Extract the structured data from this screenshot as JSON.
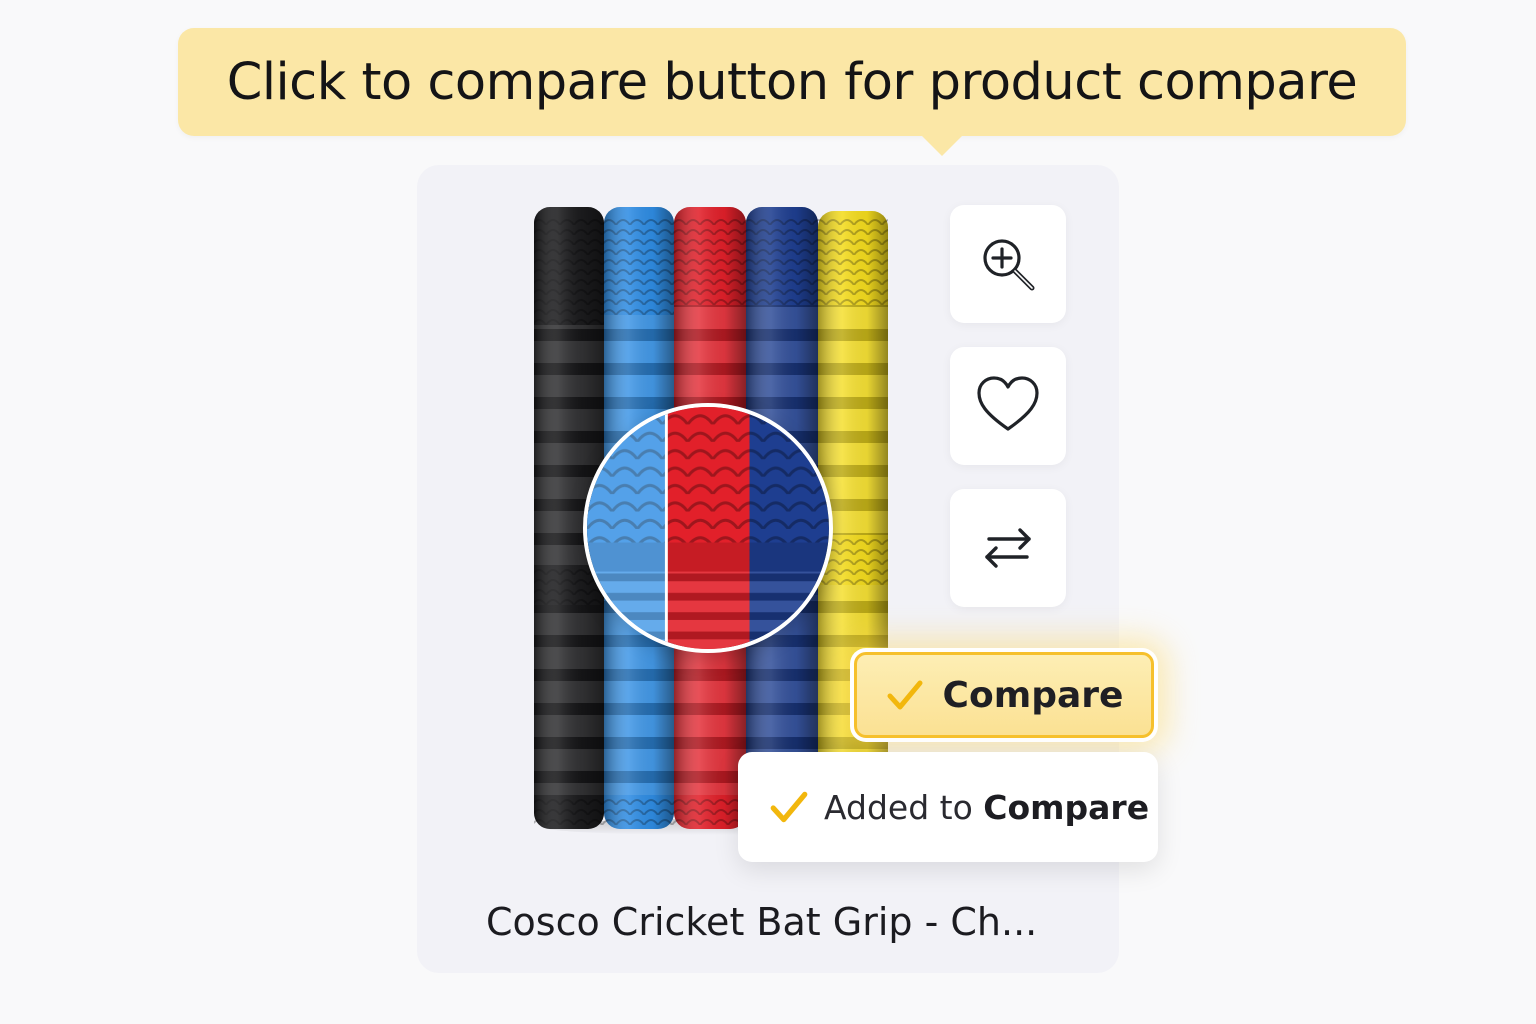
{
  "tooltip": {
    "text": "Click to compare button for product compare"
  },
  "actions": {
    "zoom_icon": "zoom-in-icon",
    "wishlist_icon": "heart-icon",
    "compare_icon": "compare-arrows-icon"
  },
  "compare_button": {
    "label": "Compare",
    "state": "checked"
  },
  "toast": {
    "prefix": "Added to",
    "strong": "Compare"
  },
  "product": {
    "title": "Cosco Cricket Bat Grip - Ch..."
  },
  "colors": {
    "accent": "#f6c02c",
    "tooltip_bg": "#fbe7a6",
    "grips": [
      "#1b1b1d",
      "#2f8de4",
      "#e2202a",
      "#1e3e90",
      "#f4dc1e"
    ]
  }
}
